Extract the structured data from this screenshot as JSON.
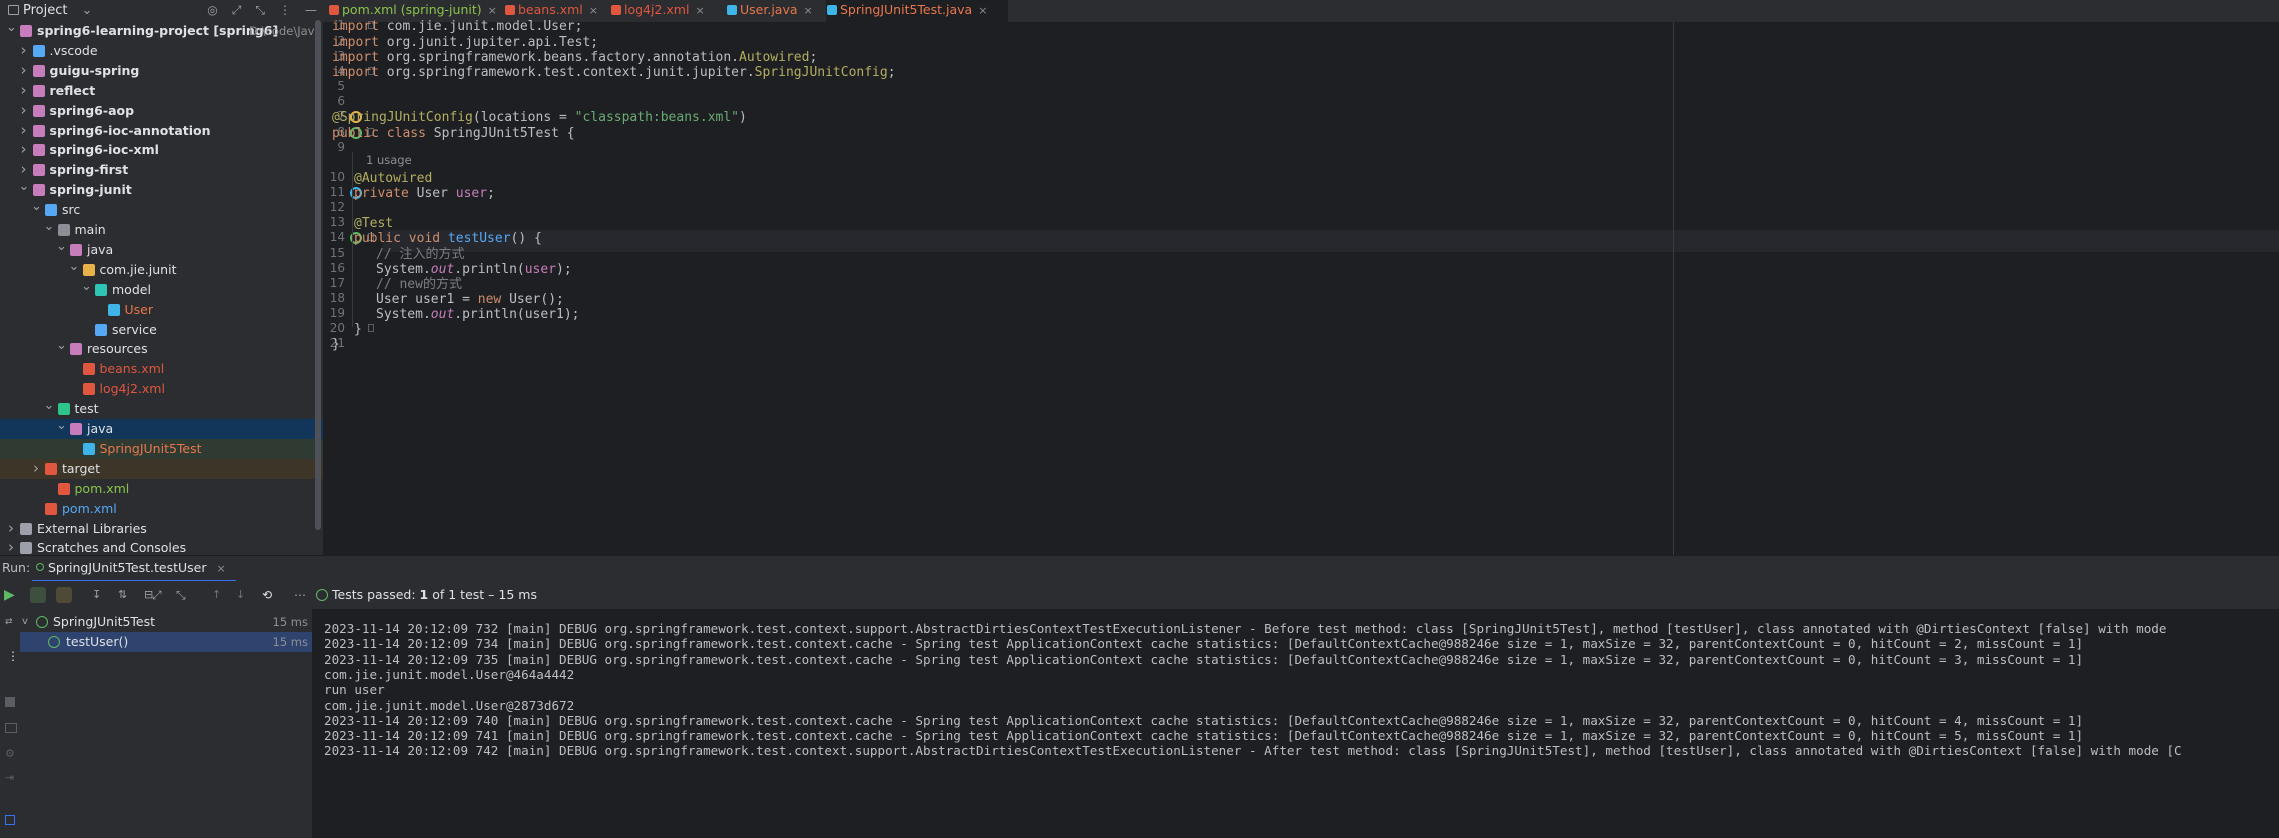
{
  "project_header": {
    "title": "Project",
    "dropdown": "⌄"
  },
  "tree": [
    {
      "label": "spring6-learning-project [spring6]",
      "path": "D:\\code\\Java",
      "indent": 0,
      "arrow": "v",
      "color": "#c77dbb",
      "bold": true
    },
    {
      "label": ".vscode",
      "indent": 1,
      "arrow": ">",
      "color": "#56a8f5",
      "bold": false
    },
    {
      "label": "guigu-spring",
      "indent": 1,
      "arrow": ">",
      "color": "#c77dbb",
      "bold": true
    },
    {
      "label": "reflect",
      "indent": 1,
      "arrow": ">",
      "color": "#c77dbb",
      "bold": true
    },
    {
      "label": "spring6-aop",
      "indent": 1,
      "arrow": ">",
      "color": "#c77dbb",
      "bold": true
    },
    {
      "label": "spring6-ioc-annotation",
      "indent": 1,
      "arrow": ">",
      "color": "#c77dbb",
      "bold": true
    },
    {
      "label": "spring6-ioc-xml",
      "indent": 1,
      "arrow": ">",
      "color": "#c77dbb",
      "bold": true
    },
    {
      "label": "spring-first",
      "indent": 1,
      "arrow": ">",
      "color": "#c77dbb",
      "bold": true
    },
    {
      "label": "spring-junit",
      "indent": 1,
      "arrow": "v",
      "color": "#c77dbb",
      "bold": true
    },
    {
      "label": "src",
      "indent": 2,
      "arrow": "v",
      "color": "#56a8f5",
      "bold": false
    },
    {
      "label": "main",
      "indent": 3,
      "arrow": "v",
      "color": "#8c8f96",
      "bold": false
    },
    {
      "label": "java",
      "indent": 4,
      "arrow": "v",
      "color": "#c77dbb",
      "bold": false
    },
    {
      "label": "com.jie.junit",
      "indent": 5,
      "arrow": "v",
      "color": "#e8b24b",
      "bold": false
    },
    {
      "label": "model",
      "indent": 6,
      "arrow": "v",
      "color": "#2ec4b6",
      "bold": false
    },
    {
      "label": "User",
      "indent": 7,
      "arrow": "",
      "color": "#3fb4e8",
      "bold": false,
      "text_color": "orange"
    },
    {
      "label": "service",
      "indent": 6,
      "arrow": "",
      "color": "#56a8f5",
      "bold": false
    },
    {
      "label": "resources",
      "indent": 4,
      "arrow": "v",
      "color": "#c77dbb",
      "bold": false
    },
    {
      "label": "beans.xml",
      "indent": 5,
      "arrow": "",
      "color": "#e0563f",
      "bold": false,
      "text_color": "red"
    },
    {
      "label": "log4j2.xml",
      "indent": 5,
      "arrow": "",
      "color": "#e0563f",
      "bold": false,
      "text_color": "red"
    },
    {
      "label": "test",
      "indent": 3,
      "arrow": "v",
      "color": "#2ec48b",
      "bold": false
    },
    {
      "label": "java",
      "indent": 4,
      "arrow": "v",
      "color": "#c77dbb",
      "bold": false,
      "bg": "#12365a"
    },
    {
      "label": "SpringJUnit5Test",
      "indent": 5,
      "arrow": "",
      "color": "#3fb4e8",
      "bold": false,
      "text_color": "orange",
      "bg": "#2f3b32"
    },
    {
      "label": "target",
      "indent": 2,
      "arrow": ">",
      "color": "#e0563f",
      "bold": false,
      "bg": "#3c3528"
    },
    {
      "label": "pom.xml",
      "indent": 3,
      "arrow": "",
      "color": "#e0563f",
      "bold": false,
      "text_color": "green"
    },
    {
      "label": "pom.xml",
      "indent": 2,
      "arrow": "",
      "color": "#e0563f",
      "bold": false,
      "text_color": "blue"
    },
    {
      "label": "External Libraries",
      "indent": 0,
      "arrow": ">",
      "color": "#9da0a8",
      "bold": false
    },
    {
      "label": "Scratches and Consoles",
      "indent": 0,
      "arrow": ">",
      "color": "#9da0a8",
      "bold": false
    }
  ],
  "tabs": [
    {
      "label": "pom.xml (spring-junit)",
      "color": "#8bc34a",
      "icon": "#e0563f",
      "active": false
    },
    {
      "label": "beans.xml",
      "color": "#e0563f",
      "icon": "#e0563f",
      "active": false
    },
    {
      "label": "log4j2.xml",
      "color": "#e0563f",
      "icon": "#e0563f",
      "active": false
    },
    {
      "label": "User.java",
      "color": "#e8774b",
      "icon": "#3fb4e8",
      "active": false
    },
    {
      "label": "SpringJUnit5Test.java",
      "color": "#e8774b",
      "icon": "#3fb4e8",
      "active": true
    }
  ],
  "tab_close": "×",
  "code_hint": "1 usage",
  "line_numbers": [
    "1",
    "2",
    "3",
    "4",
    "5",
    "6",
    "7",
    "8",
    "9",
    "10",
    "11",
    "12",
    "13",
    "14",
    "15",
    "16",
    "17",
    "18",
    "19",
    "20",
    "21"
  ],
  "code": {
    "l1": [
      "import ",
      "com.jie.junit.model.User",
      ";"
    ],
    "l2": [
      "import ",
      "org.junit.jupiter.api.",
      "Test",
      ";"
    ],
    "l3": [
      "import ",
      "org.springframework.beans.factory.annotation.",
      "Autowired",
      ";"
    ],
    "l4": [
      "import ",
      "org.springframework.test.context.junit.jupiter.",
      "SpringJUnitConfig",
      ";"
    ],
    "l7": [
      "@SpringJUnitConfig",
      "(locations = ",
      "\"classpath:beans.xml\"",
      ")"
    ],
    "l8": [
      "public class ",
      "SpringJUnit5Test {"
    ],
    "l10": [
      "@Autowired"
    ],
    "l11": [
      "private ",
      "User ",
      "user",
      ";"
    ],
    "l13": [
      "@Test"
    ],
    "l14": [
      "public void ",
      "testUser",
      "() ",
      "{"
    ],
    "l15": [
      "// 注入的方式"
    ],
    "l16": [
      "System.",
      "out",
      ".println(",
      "user",
      ");"
    ],
    "l17": [
      "// new的方式"
    ],
    "l18": [
      "User user1 = ",
      "new ",
      "User();"
    ],
    "l19": [
      "System.",
      "out",
      ".println(user1);"
    ],
    "l20": [
      "}"
    ],
    "l21": [
      "}"
    ]
  },
  "run": {
    "label": "Run:",
    "tab": "SpringJUnit5Test.testUser",
    "close": "×",
    "status_prefix": "Tests passed:",
    "status_count": "1",
    "status_suffix": "of 1 test – 15 ms",
    "tree": [
      {
        "label": "SpringJUnit5Test",
        "time": "15 ms"
      },
      {
        "label": "testUser()",
        "time": "15 ms"
      }
    ]
  },
  "console": [
    "2023-11-14 20:12:09 732 [main] DEBUG org.springframework.test.context.support.AbstractDirtiesContextTestExecutionListener - Before test method: class [SpringJUnit5Test], method [testUser], class annotated with @DirtiesContext [false] with mode",
    "2023-11-14 20:12:09 734 [main] DEBUG org.springframework.test.context.cache - Spring test ApplicationContext cache statistics: [DefaultContextCache@988246e size = 1, maxSize = 32, parentContextCount = 0, hitCount = 2, missCount = 1]",
    "2023-11-14 20:12:09 735 [main] DEBUG org.springframework.test.context.cache - Spring test ApplicationContext cache statistics: [DefaultContextCache@988246e size = 1, maxSize = 32, parentContextCount = 0, hitCount = 3, missCount = 1]",
    "com.jie.junit.model.User@464a4442",
    "run user",
    "com.jie.junit.model.User@2873d672",
    "2023-11-14 20:12:09 740 [main] DEBUG org.springframework.test.context.cache - Spring test ApplicationContext cache statistics: [DefaultContextCache@988246e size = 1, maxSize = 32, parentContextCount = 0, hitCount = 4, missCount = 1]",
    "2023-11-14 20:12:09 741 [main] DEBUG org.springframework.test.context.cache - Spring test ApplicationContext cache statistics: [DefaultContextCache@988246e size = 1, maxSize = 32, parentContextCount = 0, hitCount = 5, missCount = 1]",
    "2023-11-14 20:12:09 742 [main] DEBUG org.springframework.test.context.support.AbstractDirtiesContextTestExecutionListener - After test method: class [SpringJUnit5Test], method [testUser], class annotated with @DirtiesContext [false] with mode [C"
  ]
}
